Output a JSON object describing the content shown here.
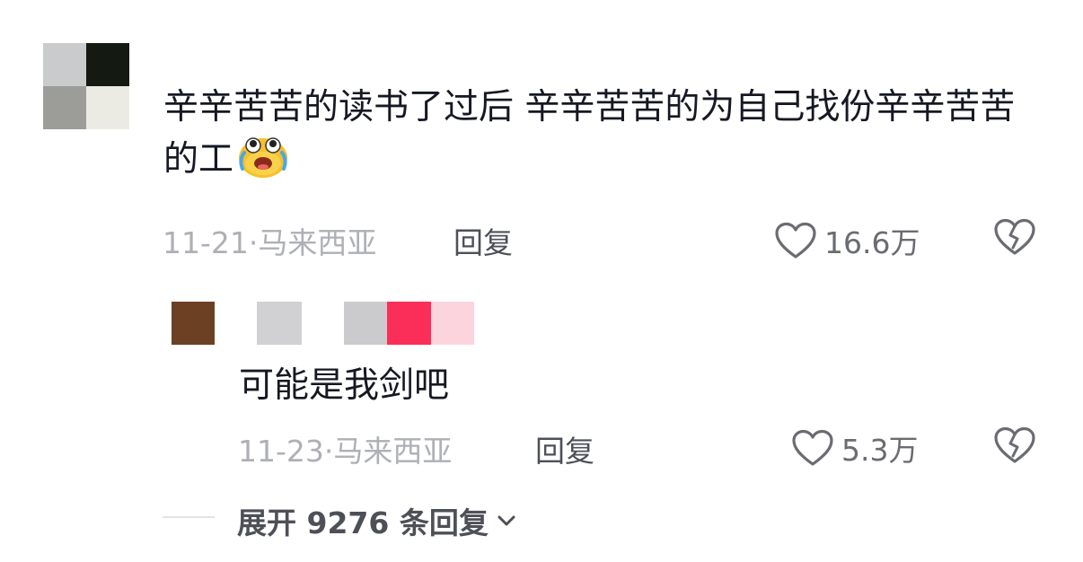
{
  "comment": {
    "text": "辛辛苦苦的读书了过后 辛辛苦苦的为自己找份辛辛苦苦的工",
    "emoji": "crying-laughing-emoji",
    "date": "11-21·",
    "location": "马来西亚",
    "reply_label": "回复",
    "likes": "16.6万"
  },
  "reply": {
    "text": "可能是我剑吧",
    "date": "11-23·",
    "location": "马来西亚",
    "reply_label": "回复",
    "likes": "5.3万"
  },
  "expand": {
    "label": "展开 9276 条回复"
  },
  "colors": {
    "text_primary": "#161823",
    "text_meta": "#aeb0b5",
    "icon": "#6a6c72"
  }
}
